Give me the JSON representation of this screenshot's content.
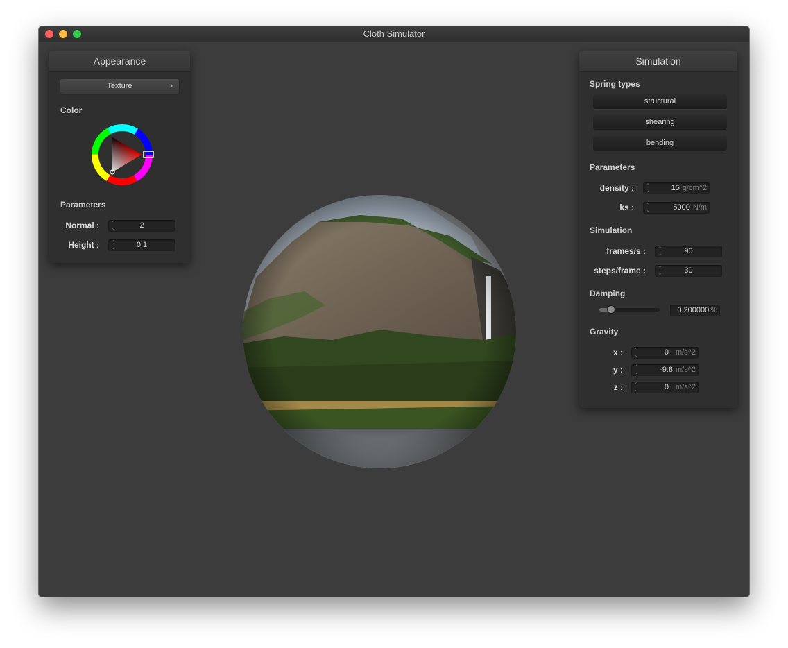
{
  "window": {
    "title": "Cloth Simulator"
  },
  "appearance": {
    "header": "Appearance",
    "shader_dropdown": "Texture",
    "color_label": "Color",
    "color_value": "#ff0000",
    "parameters_label": "Parameters",
    "params": [
      {
        "label": "Normal :",
        "value": "2"
      },
      {
        "label": "Height :",
        "value": "0.1"
      }
    ]
  },
  "simulation": {
    "header": "Simulation",
    "spring_types_label": "Spring types",
    "spring_buttons": [
      "structural",
      "shearing",
      "bending"
    ],
    "parameters_label": "Parameters",
    "params": [
      {
        "label": "density :",
        "value": "15",
        "unit": "g/cm^2"
      },
      {
        "label": "ks :",
        "value": "5000",
        "unit": "N/m"
      }
    ],
    "simulation_label": "Simulation",
    "sim_params": [
      {
        "label": "frames/s :",
        "value": "90"
      },
      {
        "label": "steps/frame :",
        "value": "30"
      }
    ],
    "damping_label": "Damping",
    "damping": {
      "value": "0.200000",
      "unit": "%",
      "level": 0.2
    },
    "gravity_label": "Gravity",
    "gravity": [
      {
        "label": "x :",
        "value": "0",
        "unit": "m/s^2"
      },
      {
        "label": "y :",
        "value": "-9.8",
        "unit": "m/s^2"
      },
      {
        "label": "z :",
        "value": "0",
        "unit": "m/s^2"
      }
    ]
  }
}
